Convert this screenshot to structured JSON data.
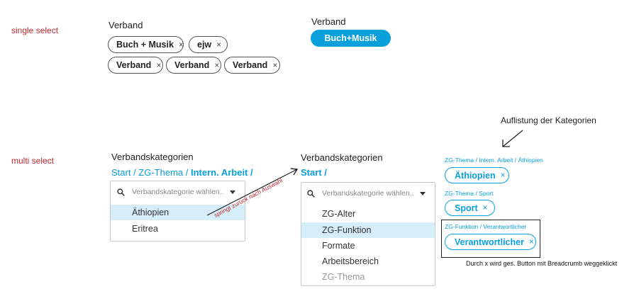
{
  "single_select": {
    "row_label": "single select",
    "left_heading": "Verband",
    "chips_row1": [
      {
        "label": "Buch + Musik",
        "close": "×"
      },
      {
        "label": "ejw",
        "close": "×"
      }
    ],
    "chips_row2": [
      {
        "label": "Verband",
        "close": "×"
      },
      {
        "label": "Verband",
        "close": "×"
      },
      {
        "label": "Verband",
        "close": "×"
      }
    ],
    "right_heading": "Verband",
    "selected_pill": "Buch+Musik"
  },
  "multi_select": {
    "row_label": "multi select",
    "left": {
      "heading": "Verbandskategorien",
      "breadcrumb_plain": "Start / ZG-Thema / ",
      "breadcrumb_bold": "Intern. Arbeit /",
      "placeholder": "Verbandskategorie wählen..",
      "options": [
        {
          "label": "Äthiopien",
          "state": "selected"
        },
        {
          "label": "Eritrea",
          "state": "normal"
        }
      ]
    },
    "arrow_note": "springt zurück nach Auswahl",
    "right": {
      "heading": "Verbandskategorien",
      "breadcrumb_bold": "Start /",
      "placeholder": "Verbandskategorie wählen..",
      "options": [
        {
          "label": "ZG-Alter",
          "state": "normal"
        },
        {
          "label": "ZG-Funktion",
          "state": "selected"
        },
        {
          "label": "Formate",
          "state": "normal"
        },
        {
          "label": "Arbeitsbereich",
          "state": "normal"
        },
        {
          "label": "ZG-Thema",
          "state": "disabled"
        }
      ]
    },
    "categories_title": "Auflistung der Kategorien",
    "categories": [
      {
        "path": "ZG-Thema / Intern. Arbeit / Äthiopien",
        "chip": "Äthiopien",
        "close": "×"
      },
      {
        "path": "ZG-Thema / Sport",
        "chip": "Sport",
        "close": "×"
      },
      {
        "path": "ZG-Funktion / Verantwortlicher",
        "chip": "Verantwortlicher",
        "close": "×"
      }
    ],
    "footnote": "Durch x wird ges. Button mit Breadcrumb weggeklickt"
  },
  "colors": {
    "accent": "#0aa0dc",
    "label_red": "#c0262d",
    "selected_row": "#d6eef9"
  },
  "icons": {
    "search": "search-icon",
    "dropdown": "caret-down-icon",
    "close": "close-icon",
    "arrow": "arrow-icon"
  }
}
